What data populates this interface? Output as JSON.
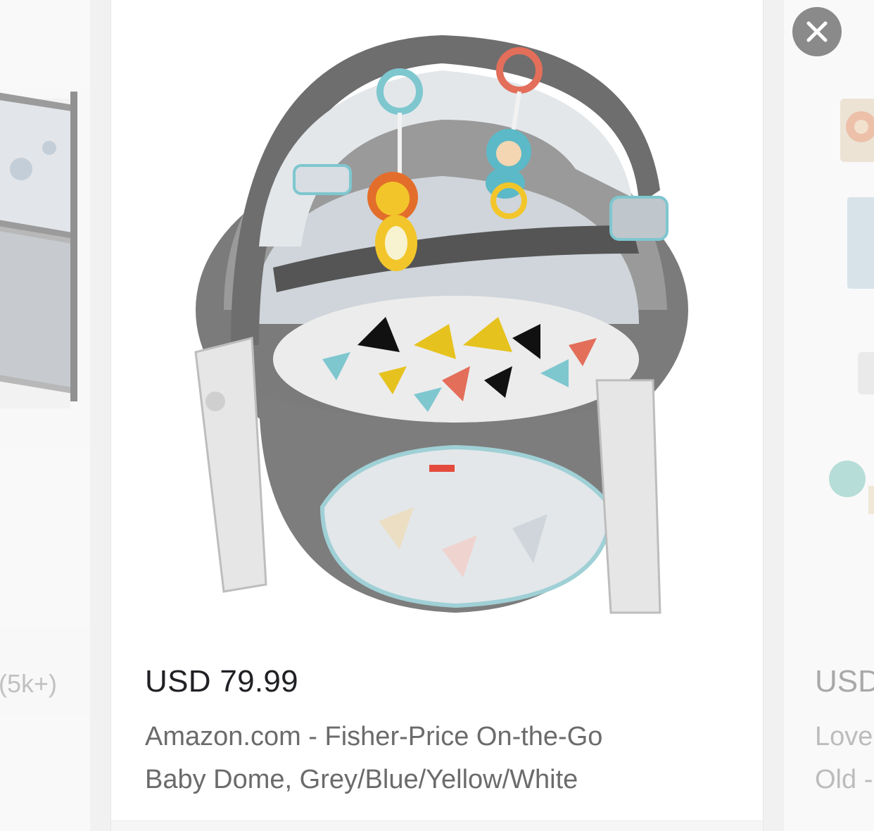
{
  "left_card": {
    "rating_count": "(5k+)"
  },
  "center_card": {
    "price": "USD 79.99",
    "title_line_1": "Amazon.com - Fisher-Price On-the-Go",
    "title_line_2": "Baby Dome, Grey/Blue/Yellow/White",
    "image_icon": "product-image-baby-dome"
  },
  "right_card": {
    "price": "USD",
    "title_line_1": "Love",
    "title_line_2": "Old -"
  },
  "close_button": {
    "icon": "close-icon"
  },
  "colors": {
    "page_bg": "#f1f1f1",
    "card_bg": "#ffffff",
    "price_text": "#202124",
    "title_text": "#6b6b6b",
    "close_bg": "#8a8a8a"
  }
}
